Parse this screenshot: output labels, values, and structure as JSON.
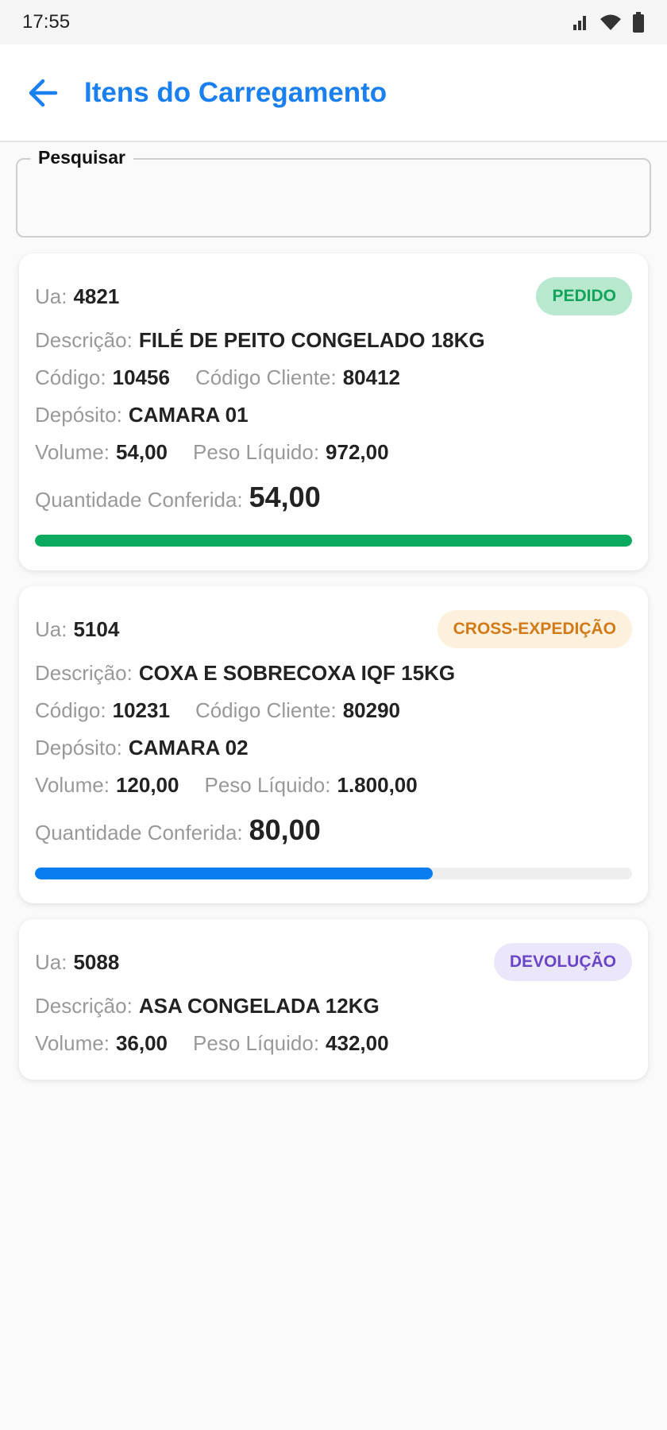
{
  "status_bar": {
    "time": "17:55"
  },
  "header": {
    "title": "Itens do Carregamento"
  },
  "search": {
    "label": "Pesquisar",
    "value": "",
    "placeholder": ""
  },
  "labels": {
    "ua": "Ua:",
    "descricao": "Descrição:",
    "codigo": "Código:",
    "codigo_cliente": "Código Cliente:",
    "deposito": "Depósito:",
    "volume": "Volume:",
    "peso_liquido": "Peso Líquido:",
    "quantidade_conferida": "Quantidade Conferida:"
  },
  "cards": [
    {
      "ua": "4821",
      "status": "PEDIDO",
      "descricao": "FILÉ DE PEITO CONGELADO 18KG",
      "codigo": "10456",
      "codigo_cliente": "80412",
      "deposito": "CAMARA 01",
      "volume": "54,00",
      "peso_liquido": "972,00",
      "quantidade_conferida": "54,00",
      "progress": 1.0,
      "progress_color": "#0caa5e"
    },
    {
      "ua": "5104",
      "status": "CROSS-EXPEDIÇÃO",
      "descricao": "COXA E SOBRECOXA IQF 15KG",
      "codigo": "10231",
      "codigo_cliente": "80290",
      "deposito": "CAMARA 02",
      "volume": "120,00",
      "peso_liquido": "1.800,00",
      "quantidade_conferida": "80,00",
      "progress": 0.6667,
      "progress_color": "#0a7ef0"
    },
    {
      "ua": "5088",
      "status": "DEVOLUÇÃO",
      "descricao": "ASA CONGELADA 12KG",
      "volume": "36,00",
      "peso_liquido": "432,00"
    }
  ],
  "colors": {
    "accent": "#1a7ff0",
    "pedido_bg": "#b8e8ce",
    "pedido_fg": "#12a45a",
    "cross_bg": "#fdf0dc",
    "cross_fg": "#d27a18",
    "devolucao_bg": "#ece6fb",
    "devolucao_fg": "#6a45c8"
  },
  "icons": {
    "back": "arrow-left-icon",
    "signal": "cell-signal-icon",
    "wifi": "wifi-icon",
    "battery": "battery-icon"
  }
}
